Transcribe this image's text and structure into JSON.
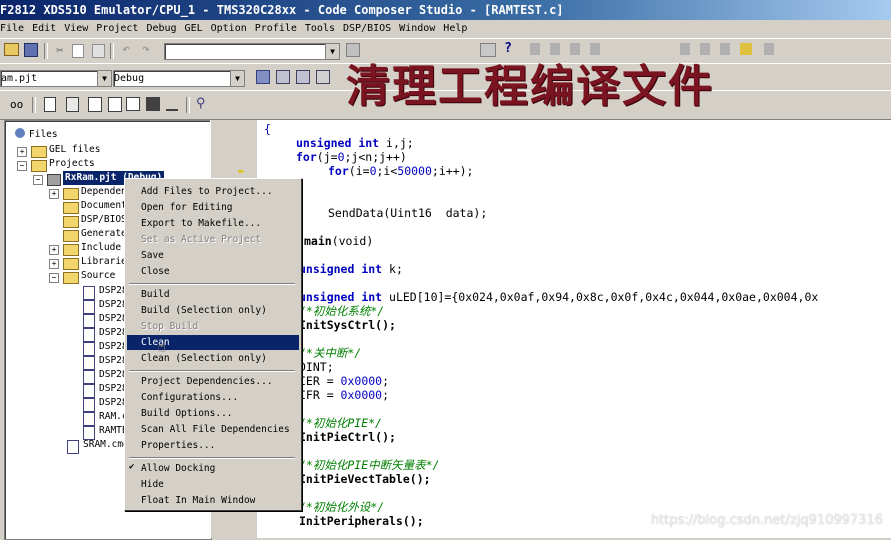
{
  "window": {
    "title": "F2812 XDS510 Emulator/CPU_1 - TMS320C28xx - Code Composer Studio - [RAMTEST.c]"
  },
  "menu": [
    "File",
    "Edit",
    "View",
    "Project",
    "Debug",
    "GEL",
    "Option",
    "Profile",
    "Tools",
    "DSP/BIOS",
    "Window",
    "Help"
  ],
  "toolbar": {
    "project_combo": "am.pjt",
    "config_combo": "Debug",
    "search_combo": ""
  },
  "overlay_title": "清理工程编译文件",
  "project_tree": {
    "root": "Files",
    "gel": "GEL files",
    "projects": "Projects",
    "project_name": "RxRam.pjt (Debug)",
    "folders": [
      "Dependen",
      "Document",
      "DSP/BIOS",
      "Generate",
      "Include",
      "Librarie",
      "Source"
    ],
    "source_files": [
      "DSP28",
      "DSP28",
      "DSP28",
      "DSP28",
      "DSP28",
      "DSP28",
      "DSP28",
      "DSP28",
      "DSP28",
      "RAM.c",
      "RAMTE"
    ],
    "extra_file": "SRAM.cmd"
  },
  "context_menu": [
    {
      "label": "Add Files to Project...",
      "disabled": false
    },
    {
      "label": "Open for Editing",
      "disabled": false
    },
    {
      "label": "Export to Makefile...",
      "disabled": false
    },
    {
      "label": "Set as Active Project",
      "disabled": true
    },
    {
      "label": "Save",
      "disabled": false
    },
    {
      "label": "Close",
      "disabled": false
    },
    {
      "label": "Build",
      "disabled": false
    },
    {
      "label": "Build (Selection only)",
      "disabled": false
    },
    {
      "label": "Stop Build",
      "disabled": true
    },
    {
      "label": "Clean",
      "disabled": false,
      "selected": true
    },
    {
      "label": "Clean (Selection only)",
      "disabled": false
    },
    {
      "label": "Project Dependencies...",
      "disabled": false
    },
    {
      "label": "Configurations...",
      "disabled": false
    },
    {
      "label": "Build Options...",
      "disabled": false
    },
    {
      "label": "Scan All File Dependencies",
      "disabled": false
    },
    {
      "label": "Properties...",
      "disabled": false
    },
    {
      "label": "Allow Docking",
      "disabled": false,
      "checked": true
    },
    {
      "label": "Hide",
      "disabled": false
    },
    {
      "label": "Float In Main Window",
      "disabled": false
    }
  ],
  "code": {
    "l1": "{",
    "l2_kw1": "unsigned",
    "l2_kw2": "int",
    "l2_rest": " i,j;",
    "l3_kw": "for",
    "l3_a": "(j=",
    "l3_n0": "0",
    "l3_b": ";j<n;j++)",
    "l4_kw": "for",
    "l4_a": "(i=",
    "l4_n0": "0",
    "l4_b": ";i<",
    "l4_n1": "50000",
    "l4_c": ";i++);",
    "l5": "SendData(Uint16  data);",
    "l6_kw": "main",
    "l6_rest": "(void)",
    "l7_kw1": "unsigned",
    "l7_kw2": "int",
    "l7_rest": " k;",
    "l8_kw1": "unsigned",
    "l8_kw2": "int",
    "l8_rest": " uLED[10]={0x024,0x0af,0x94,0x8c,0x0f,0x4c,0x044,0x0ae,0x004,0x",
    "c1": "/*初始化系统*/",
    "l9": "InitSysCtrl();",
    "c2": "/*关中断*/",
    "l10": "DINT;",
    "l11_a": "IER = ",
    "l11_n": "0x0000",
    "l11_b": ";",
    "l12_a": "IFR = ",
    "l12_n": "0x0000",
    "l12_b": ";",
    "c3": "/*初始化PIE*/",
    "l13": "InitPieCtrl();",
    "c4": "/*初始化PIE中断矢量表*/",
    "l14": "InitPieVectTable();",
    "c5": "/*初始化外设*/",
    "l15": "InitPeripherals();"
  },
  "watermark": "https://blog.csdn.net/zjq910997316"
}
